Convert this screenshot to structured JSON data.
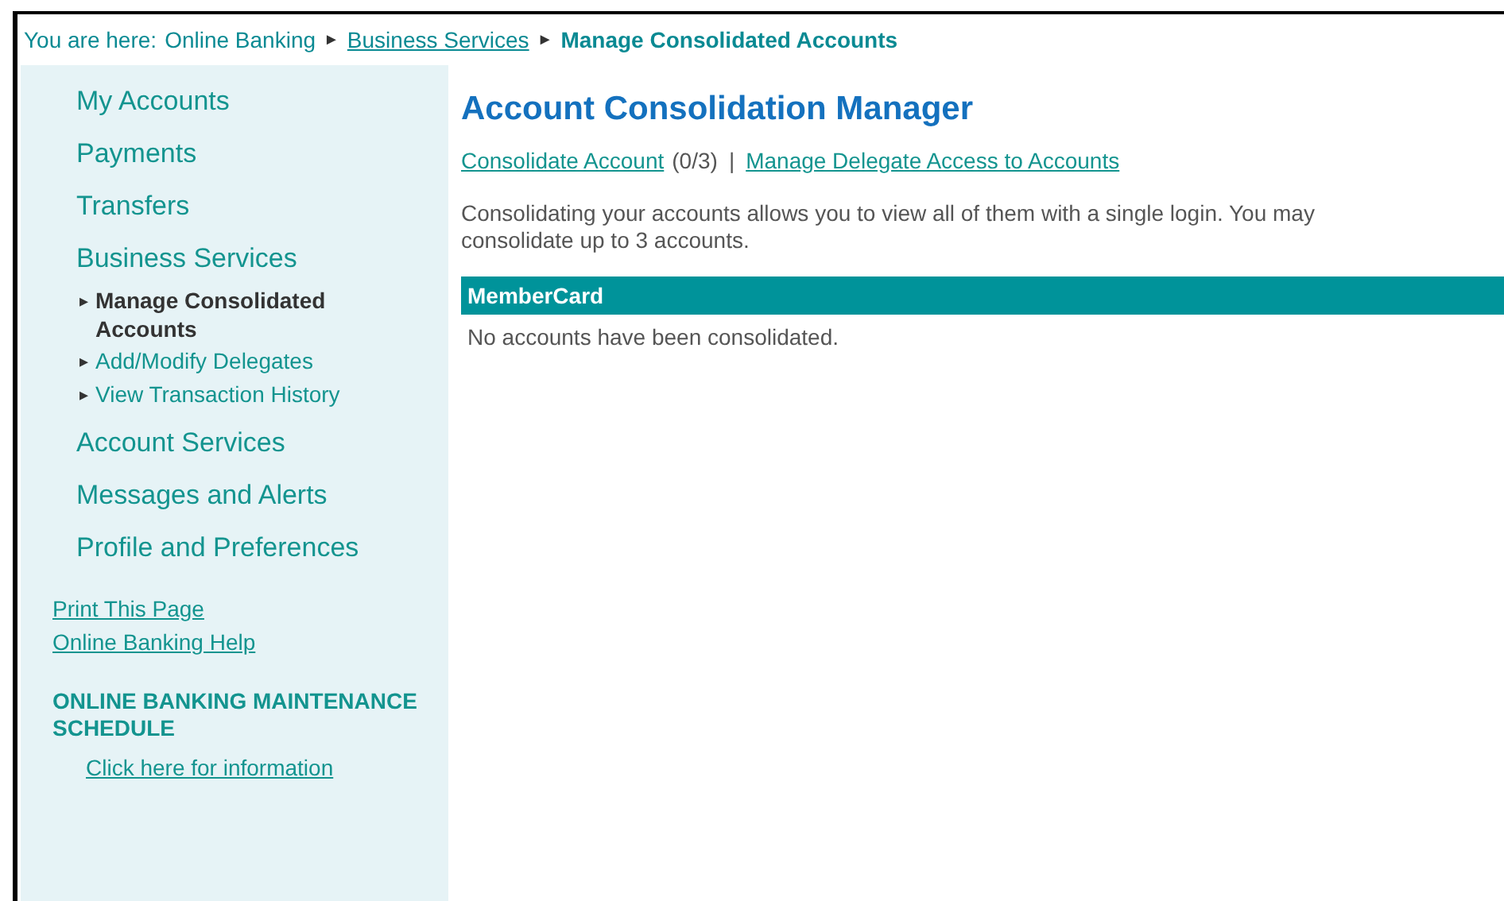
{
  "breadcrumb": {
    "label": "You are here:",
    "items": [
      {
        "kind": "text",
        "text": "Online Banking"
      },
      {
        "kind": "separator",
        "text": "►"
      },
      {
        "kind": "link",
        "text": "Business Services"
      },
      {
        "kind": "separator",
        "text": "►"
      },
      {
        "kind": "current",
        "text": "Manage Consolidated Accounts"
      }
    ]
  },
  "sidebar": {
    "items": [
      {
        "label": "My Accounts"
      },
      {
        "label": "Payments"
      },
      {
        "label": "Transfers"
      },
      {
        "label": "Business Services",
        "children": [
          {
            "marker": "▸",
            "label": "Manage Consolidated Accounts",
            "selected": true
          },
          {
            "marker": "▸",
            "label": "Add/Modify Delegates",
            "selected": false
          },
          {
            "marker": "▸",
            "label": "View Transaction History",
            "selected": false
          }
        ]
      },
      {
        "label": "Account Services"
      },
      {
        "label": "Messages and Alerts"
      },
      {
        "label": "Profile and Preferences"
      }
    ],
    "links": [
      "Print This Page",
      "Online Banking Help"
    ],
    "maintenance": {
      "heading": "ONLINE BANKING MAINTENANCE SCHEDULE",
      "link": "Click here for information"
    }
  },
  "main": {
    "title": "Account Consolidation Manager",
    "actions": {
      "consolidate_link": "Consolidate Account",
      "count": "(0/3)",
      "divider": "|",
      "delegate_link": "Manage Delegate Access to Accounts"
    },
    "description": "Consolidating your accounts allows you to view all of them with a single login. You may consolidate up to 3 accounts.",
    "table": {
      "header": "MemberCard",
      "empty_message": "No accounts have been consolidated."
    }
  }
}
